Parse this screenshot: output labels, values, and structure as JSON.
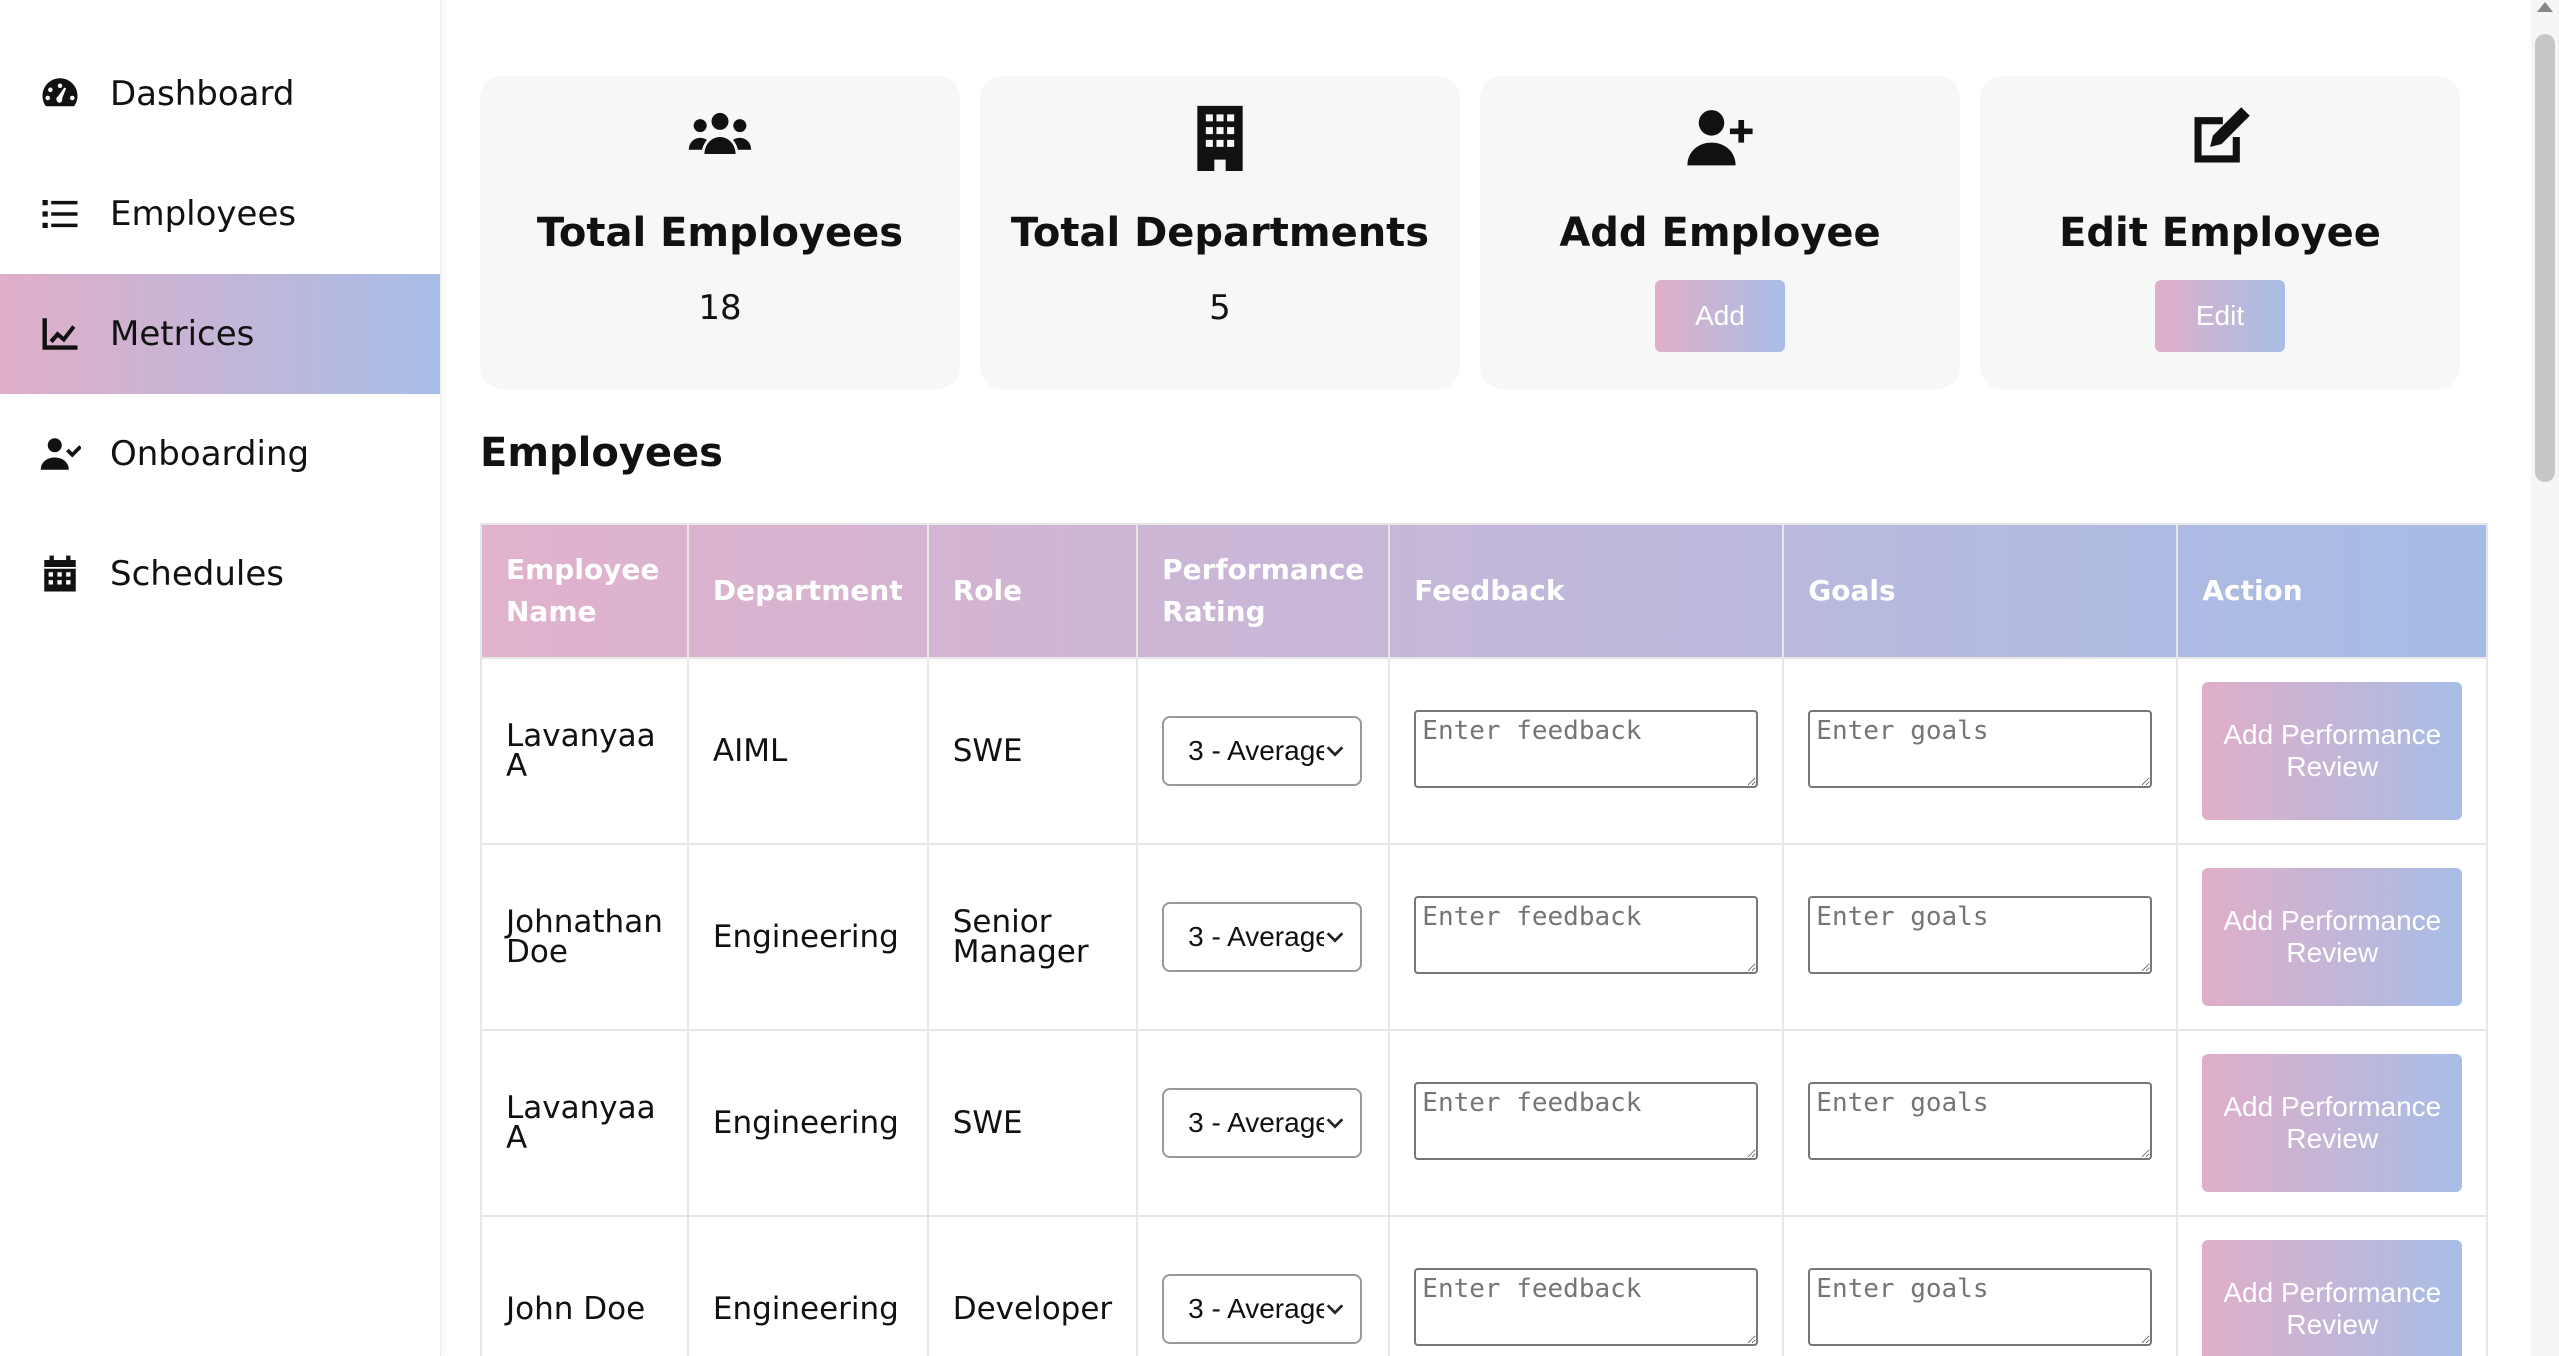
{
  "sidebar": {
    "items": [
      {
        "label": "Dashboard",
        "icon": "gauge-icon"
      },
      {
        "label": "Employees",
        "icon": "list-icon"
      },
      {
        "label": "Metrices",
        "icon": "chart-line-icon",
        "active": true
      },
      {
        "label": "Onboarding",
        "icon": "user-check-icon"
      },
      {
        "label": "Schedules",
        "icon": "calendar-icon"
      }
    ]
  },
  "cards": {
    "total_employees": {
      "title": "Total Employees",
      "value": "18",
      "icon": "users-icon"
    },
    "total_departments": {
      "title": "Total Departments",
      "value": "5",
      "icon": "building-icon"
    },
    "add_employee": {
      "title": "Add Employee",
      "button": "Add",
      "icon": "user-plus-icon"
    },
    "edit_employee": {
      "title": "Edit Employee",
      "button": "Edit",
      "icon": "edit-icon"
    }
  },
  "section_title": "Employees",
  "table": {
    "headers": [
      "Employee Name",
      "Department",
      "Role",
      "Performance Rating",
      "Feedback",
      "Goals",
      "Action"
    ],
    "rows": [
      {
        "name": "Lavanyaa A",
        "department": "AIML",
        "role": "SWE",
        "rating": "3 - Average",
        "action": "Add Performance Review"
      },
      {
        "name": "Johnathan Doe",
        "department": "Engineering",
        "role": "Senior Manager",
        "rating": "3 - Average",
        "action": "Add Performance Review"
      },
      {
        "name": "Lavanyaa A",
        "department": "Engineering",
        "role": "SWE",
        "rating": "3 - Average",
        "action": "Add Performance Review"
      },
      {
        "name": "John Doe",
        "department": "Engineering",
        "role": "Developer",
        "rating": "3 - Average",
        "action": "Add Performance Review"
      }
    ],
    "feedback_placeholder": "Enter feedback",
    "goals_placeholder": "Enter goals"
  },
  "colors": {
    "gradient_start": "#e0aec8",
    "gradient_end": "#a7bde6",
    "card_bg": "#f7f7f8"
  }
}
